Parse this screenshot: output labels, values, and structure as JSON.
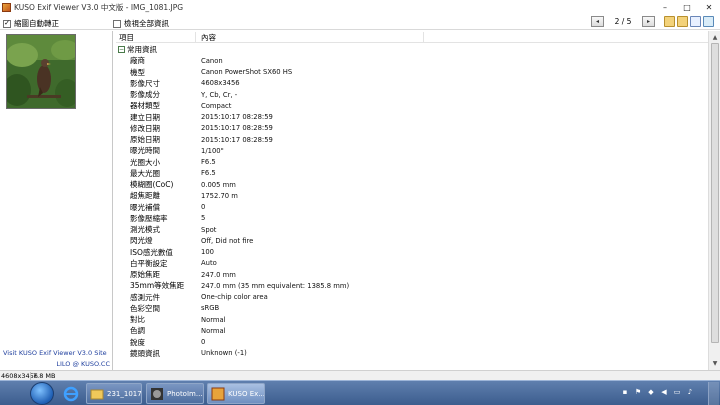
{
  "window": {
    "title": "KUSO Exif Viewer V3.0 中文版 - IMG_1081.JPG",
    "minimize": "–",
    "maximize": "□",
    "close": "✕"
  },
  "toolbar": {
    "auto_rotate_label": "縮圖自動轉正",
    "auto_rotate_checked": "✓",
    "show_all_label": "檢視全部資訊",
    "prev": "◂",
    "page": "2 / 5",
    "next": "▸"
  },
  "left_panel": {
    "visit_text": "Visit KUSO Exif Viewer V3.0 Site",
    "credit": "LILO @ KUSO.CC"
  },
  "table": {
    "headers": [
      "項目",
      "內容"
    ],
    "group_label": "常用資訊",
    "rows": [
      {
        "k": "廠商",
        "v": "Canon"
      },
      {
        "k": "機型",
        "v": "Canon PowerShot SX60 HS"
      },
      {
        "k": "影像尺寸",
        "v": "4608x3456"
      },
      {
        "k": "影像成分",
        "v": "Y, Cb, Cr, -"
      },
      {
        "k": "器材類型",
        "v": "Compact"
      },
      {
        "k": "建立日期",
        "v": "2015:10:17 08:28:59"
      },
      {
        "k": "修改日期",
        "v": "2015:10:17 08:28:59"
      },
      {
        "k": "原始日期",
        "v": "2015:10:17 08:28:59"
      },
      {
        "k": "曝光時間",
        "v": "1/100\""
      },
      {
        "k": "光圈大小",
        "v": "F6.5"
      },
      {
        "k": "最大光圈",
        "v": "F6.5"
      },
      {
        "k": "模糊圈(CoC)",
        "v": "0.005 mm"
      },
      {
        "k": "超焦距離",
        "v": "1752.70 m"
      },
      {
        "k": "曝光補償",
        "v": "0"
      },
      {
        "k": "影像壓縮率",
        "v": "5"
      },
      {
        "k": "測光模式",
        "v": "Spot"
      },
      {
        "k": "閃光燈",
        "v": "Off, Did not fire"
      },
      {
        "k": "ISO感光數值",
        "v": "100"
      },
      {
        "k": "白平衡設定",
        "v": "Auto"
      },
      {
        "k": "原始焦距",
        "v": "247.0 mm"
      },
      {
        "k": "35mm等效焦距",
        "v": "247.0 mm (35 mm equivalent: 1385.8 mm)"
      },
      {
        "k": "感測元件",
        "v": "One-chip color area"
      },
      {
        "k": "色彩空間",
        "v": "sRGB"
      },
      {
        "k": "對比",
        "v": "Normal"
      },
      {
        "k": "色調",
        "v": "Normal"
      },
      {
        "k": "銳度",
        "v": "0"
      },
      {
        "k": "鏡頭資訊",
        "v": "Unknown (-1)"
      }
    ]
  },
  "status": {
    "dimensions": "4608x3456",
    "size": "7.8 MB"
  },
  "taskbar": {
    "tasks": [
      "231_1017",
      "PhotoIm...",
      "KUSO Ex..."
    ]
  },
  "colors": {
    "link_blue": "#1f3f9e",
    "taskbar_blue": "#3c5d8e"
  }
}
